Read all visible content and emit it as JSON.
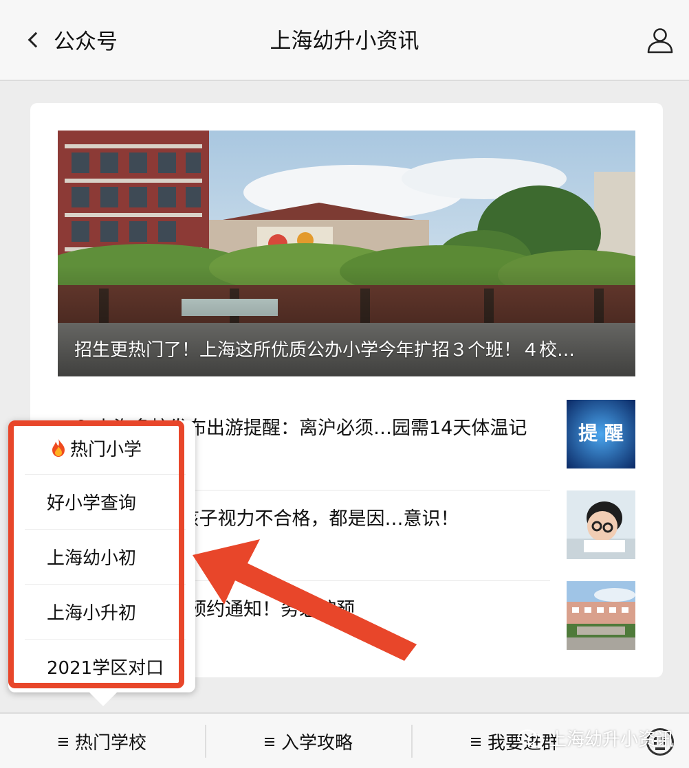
{
  "header": {
    "back_label": "公众号",
    "title": "上海幼升小资讯"
  },
  "hero": {
    "caption": "招生更热门了！上海这所优质公办小学今年扩招３个班！４校…"
  },
  "articles": [
    {
      "title": "…？上海多校发布出游提醒：离沪必须…园需14天体温记录！"
    },
    {
      "title": "…果惊人：2/3孩子视力不合格，都是因…意识！"
    },
    {
      "title": "…心小学发布…预约通知！务必按预"
    }
  ],
  "popup": {
    "items": [
      {
        "label": "热门小学",
        "icon": "fire-icon"
      },
      {
        "label": "好小学查询"
      },
      {
        "label": "上海幼小初"
      },
      {
        "label": "上海小升初"
      },
      {
        "label": "2021学区对口"
      }
    ]
  },
  "bottombar": {
    "tabs": [
      {
        "label": "热门学校"
      },
      {
        "label": "入学攻略"
      },
      {
        "label": "我要进群"
      }
    ]
  },
  "watermark": {
    "text": "上海幼升小资讯"
  },
  "colors": {
    "annotation_red": "#e8462a",
    "background": "#ededed"
  }
}
